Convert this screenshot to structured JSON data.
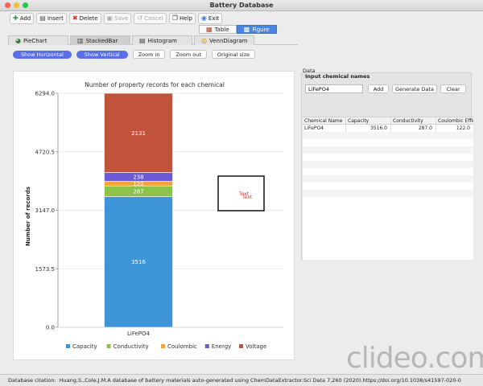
{
  "window": {
    "title": "Battery Database"
  },
  "toolbar": {
    "add": "Add",
    "insert": "Insert",
    "delete": "Delete",
    "save": "Save",
    "cancel": "Cancel",
    "help": "Help",
    "exit": "Exit"
  },
  "view_tabs": {
    "table": "Table",
    "figure": "Figure",
    "selected": "Figure"
  },
  "chart_tabs": {
    "pie": "PieChart",
    "stacked": "StackedBar",
    "histogram": "Histogram",
    "venn": "VennDiagram",
    "selected": "StackedBar"
  },
  "controls": {
    "show_horizontal": "Show Horizontal",
    "show_vertical": "Show Vertical",
    "zoom_in": "Zoom in",
    "zoom_out": "Zoom out",
    "original_size": "Original size"
  },
  "chart_data": {
    "type": "bar",
    "stacked": true,
    "title": "Number of property records for each chemical",
    "xlabel": "",
    "ylabel": "Number of records",
    "categories": [
      "LiFePO4"
    ],
    "ylim": [
      0,
      6294
    ],
    "yticks": [
      "0.0",
      "1573.5",
      "3147.0",
      "4720.5",
      "6294.0"
    ],
    "grid": true,
    "legend_position": "bottom",
    "series": [
      {
        "name": "Capacity",
        "values": [
          3516
        ],
        "color": "#3d95d8"
      },
      {
        "name": "Conductivity",
        "values": [
          287
        ],
        "color": "#8cc34a"
      },
      {
        "name": "Coulombic",
        "values": [
          122
        ],
        "color": "#f0a53c"
      },
      {
        "name": "Energy",
        "values": [
          238
        ],
        "color": "#6a5ad6"
      },
      {
        "name": "Voltage",
        "values": [
          2131
        ],
        "color": "#c1533a"
      }
    ],
    "tooltip_text": "Text"
  },
  "side": {
    "data_label": "Data",
    "input_label": "Input chemical names",
    "input_value": "LiFePO4",
    "add_button": "Add",
    "generate_button": "Generate Data",
    "clear_button": "Clear",
    "table": {
      "headers": [
        "Chemical Name",
        "Capacity",
        "Conductivity",
        "Coulombic Effic"
      ],
      "rows": [
        [
          "LiFePO4",
          "3516.0",
          "287.0",
          "122.0"
        ]
      ]
    }
  },
  "watermark": "clideo.com",
  "status": {
    "label": "Database citation:",
    "text": "Huang,S.,Cole,J.M.A database of battery materials auto-generated using ChemDataExtractor.Sci Data 7,260 (2020).https://doi.org/10.1038/s41597-020-0"
  }
}
